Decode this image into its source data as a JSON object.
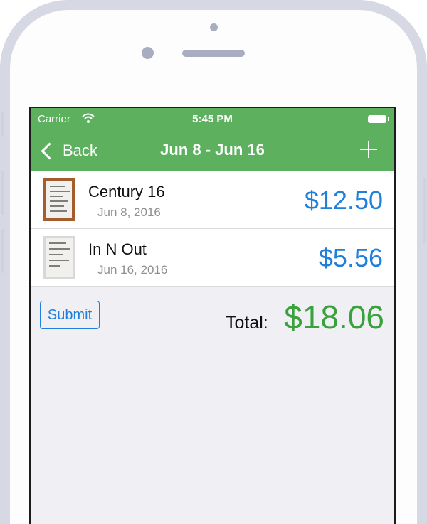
{
  "status": {
    "carrier": "Carrier",
    "time": "5:45 PM"
  },
  "nav": {
    "back_label": "Back",
    "title": "Jun 8 - Jun 16"
  },
  "receipts": [
    {
      "name": "Century 16",
      "date": "Jun 8, 2016",
      "amount": "$12.50"
    },
    {
      "name": "In N Out",
      "date": "Jun 16, 2016",
      "amount": "$5.56"
    }
  ],
  "footer": {
    "submit_label": "Submit",
    "total_label": "Total:",
    "total_value": "$18.06"
  },
  "colors": {
    "nav": "#5cb05e",
    "amount": "#1f7fdc",
    "total": "#3aa23d"
  },
  "icons": [
    "wifi-icon",
    "battery-icon",
    "back-chevron-icon",
    "add-icon"
  ]
}
